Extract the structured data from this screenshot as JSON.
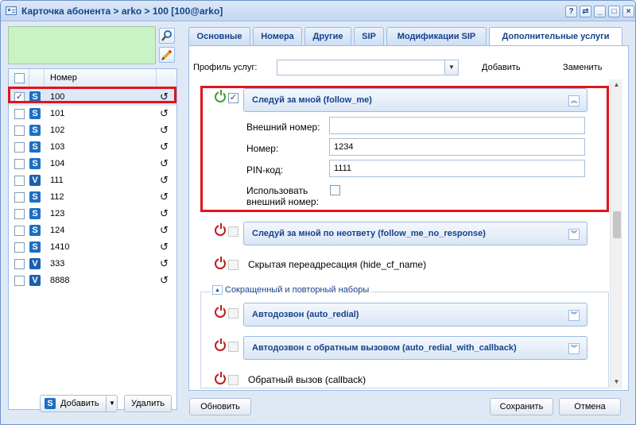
{
  "window": {
    "title": "Карточка абонента > arko > 100 [100@arko]",
    "controls": [
      "?",
      "⇄",
      "_",
      "□",
      "×"
    ]
  },
  "left": {
    "header_number": "Номер",
    "rows": [
      {
        "number": "100",
        "type": "S",
        "checked": true
      },
      {
        "number": "101",
        "type": "S",
        "checked": false
      },
      {
        "number": "102",
        "type": "S",
        "checked": false
      },
      {
        "number": "103",
        "type": "S",
        "checked": false
      },
      {
        "number": "104",
        "type": "S",
        "checked": false
      },
      {
        "number": "111",
        "type": "V",
        "checked": false
      },
      {
        "number": "112",
        "type": "S",
        "checked": false
      },
      {
        "number": "123",
        "type": "S",
        "checked": false
      },
      {
        "number": "124",
        "type": "S",
        "checked": false
      },
      {
        "number": "1410",
        "type": "S",
        "checked": false
      },
      {
        "number": "333",
        "type": "V",
        "checked": false
      },
      {
        "number": "8888",
        "type": "V",
        "checked": false
      }
    ],
    "add_label": "Добавить",
    "delete_label": "Удалить",
    "add_icon_letter": "S"
  },
  "tabs": [
    {
      "label": "Основные",
      "active": false
    },
    {
      "label": "Номера",
      "active": false
    },
    {
      "label": "Другие",
      "active": false
    },
    {
      "label": "SIP",
      "active": false
    },
    {
      "label": "Модификации SIP",
      "active": false
    },
    {
      "label": "Дополнительные услуги",
      "active": true
    }
  ],
  "profile": {
    "label": "Профиль услуг:",
    "value": "",
    "add_label": "Добавить",
    "replace_label": "Заменить"
  },
  "services": {
    "follow_me": {
      "title": "Следуй за мной (follow_me)",
      "enabled": true,
      "checked": true,
      "external_number_label": "Внешний номер:",
      "external_number_value": "",
      "number_label": "Номер:",
      "number_value": "1234",
      "pin_label": "PIN-код:",
      "pin_value": "1111",
      "use_external_label_1": "Использовать",
      "use_external_label_2": "внешний номер:"
    },
    "follow_me_no_response": {
      "title": "Следуй за мной по неответу (follow_me_no_response)"
    },
    "hide_cf_name": {
      "title": "Скрытая переадресация (hide_cf_name)"
    },
    "group_title": "Сокращенный и повторный наборы",
    "auto_redial": {
      "title": "Автодозвон (auto_redial)"
    },
    "auto_redial_with_callback": {
      "title": "Автодозвон с обратным вызовом (auto_redial_with_callback)"
    },
    "callback": {
      "title": "Обратный вызов (callback)"
    }
  },
  "footer": {
    "refresh_label": "Обновить",
    "save_label": "Сохранить",
    "cancel_label": "Отмена"
  },
  "colors": {
    "accent": "#15428b",
    "highlight_box": "#e0141e",
    "power_off": "#c31a1a",
    "power_on": "#3da02e"
  }
}
